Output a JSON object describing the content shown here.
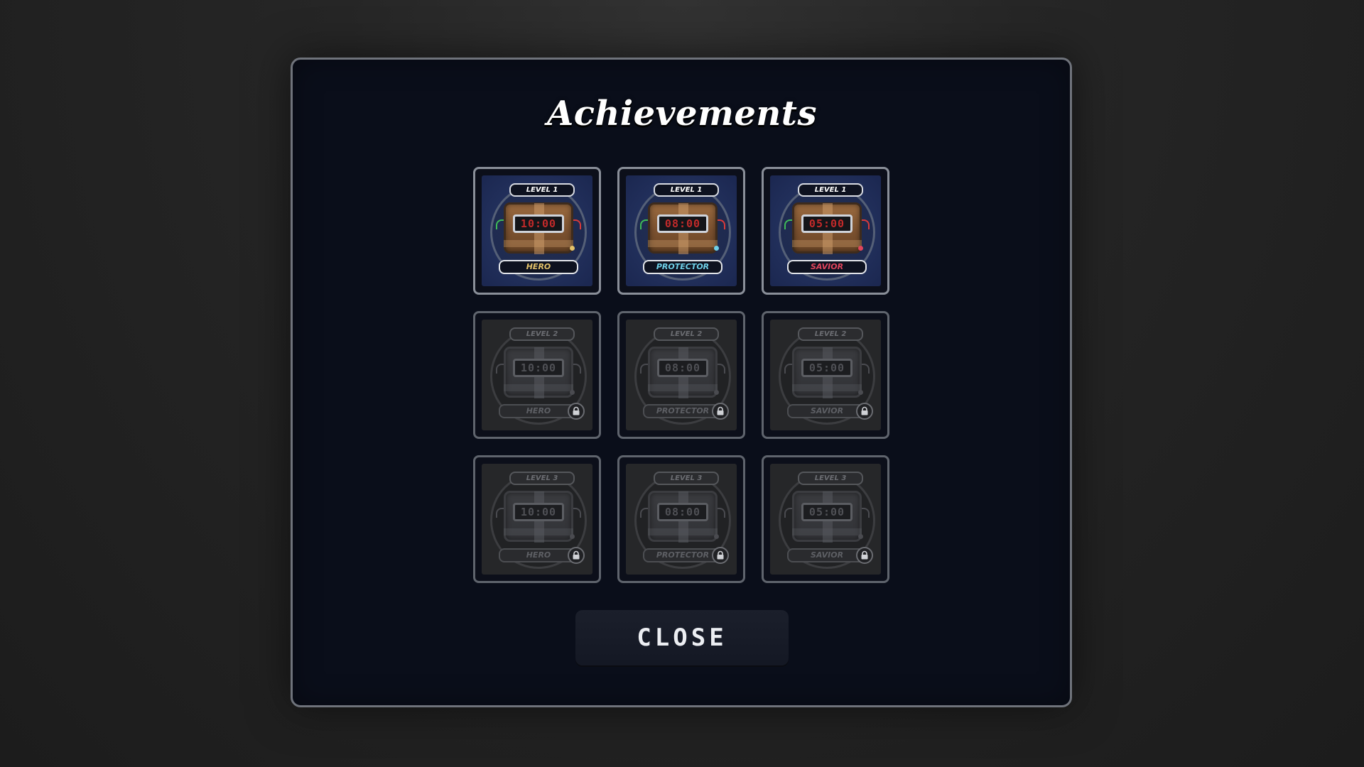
{
  "title": "Achievements",
  "close_label": "CLOSE",
  "colors": {
    "hero": "#e3c26a",
    "protector": "#6fd0e8",
    "savior": "#e0455c"
  },
  "icons": {
    "achievement": "bomb-timer-icon",
    "locked": "padlock-icon"
  },
  "achievements": [
    {
      "level": "LEVEL 1",
      "name": "HERO",
      "timer": "10:00",
      "unlocked": true
    },
    {
      "level": "LEVEL 1",
      "name": "PROTECTOR",
      "timer": "08:00",
      "unlocked": true
    },
    {
      "level": "LEVEL 1",
      "name": "SAVIOR",
      "timer": "05:00",
      "unlocked": true
    },
    {
      "level": "LEVEL 2",
      "name": "HERO",
      "timer": "10:00",
      "unlocked": false
    },
    {
      "level": "LEVEL 2",
      "name": "PROTECTOR",
      "timer": "08:00",
      "unlocked": false
    },
    {
      "level": "LEVEL 2",
      "name": "SAVIOR",
      "timer": "05:00",
      "unlocked": false
    },
    {
      "level": "LEVEL 3",
      "name": "HERO",
      "timer": "10:00",
      "unlocked": false
    },
    {
      "level": "LEVEL 3",
      "name": "PROTECTOR",
      "timer": "08:00",
      "unlocked": false
    },
    {
      "level": "LEVEL 3",
      "name": "SAVIOR",
      "timer": "05:00",
      "unlocked": false
    }
  ]
}
